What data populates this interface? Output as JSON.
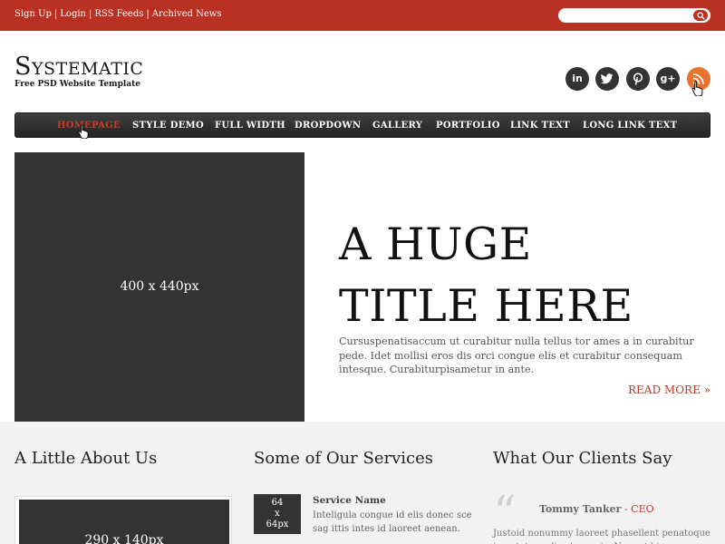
{
  "topbar": {
    "links": [
      "Sign Up",
      "Login",
      "RSS Feeds",
      "Archived News"
    ],
    "separator": "|",
    "search_placeholder": ""
  },
  "header": {
    "logo": "Systematic",
    "tagline": "Free PSD Website Template",
    "social": [
      {
        "icon": "linkedin-icon",
        "glyph": "in"
      },
      {
        "icon": "twitter-icon",
        "glyph": "t"
      },
      {
        "icon": "pinterest-icon",
        "glyph": "p"
      },
      {
        "icon": "googleplus-icon",
        "glyph": "g+"
      },
      {
        "icon": "rss-icon",
        "glyph": ""
      }
    ]
  },
  "nav": {
    "items": [
      "HOMEPAGE",
      "STYLE DEMO",
      "FULL WIDTH",
      "DROPDOWN",
      "GALLERY",
      "PORTFOLIO",
      "LINK TEXT",
      "LONG LINK TEXT"
    ],
    "active": "HOMEPAGE"
  },
  "hero": {
    "image_label": "400 x 440px",
    "title_line1": "A HUGE",
    "title_line2": "TITLE HERE",
    "text": "Cursuspenatisaccum ut curabitur nulla tellus tor ames a in curabitur pede. Idet mollisi eros dis orci congue elis et curabitur consequam intesque. Curabiturpisametur in ante.",
    "read_more": "READ MORE »"
  },
  "about": {
    "title": "A Little About Us",
    "image_label": "290 x 140px"
  },
  "services": {
    "title": "Some of Our Services",
    "image_label_line1": "64",
    "image_label_line2": "x",
    "image_label_line3": "64px",
    "service_name": "Service Name",
    "service_text": "Inteligula congue id elis donec sce sag ittis intes id laoreet aenean."
  },
  "clients": {
    "title": "What Our Clients Say",
    "quote_mark": "“",
    "name": "Tommy Tanker",
    "role": " - CEO",
    "text": "Justoid nonummy laoreet phasellent penatoque in antetum elis et mauris. Nequat bi"
  },
  "colors": {
    "brand_red": "#b93122",
    "nav_dark": "#2f2f2f",
    "rss_orange": "#e8732f",
    "placeholder_gray": "#333333"
  }
}
